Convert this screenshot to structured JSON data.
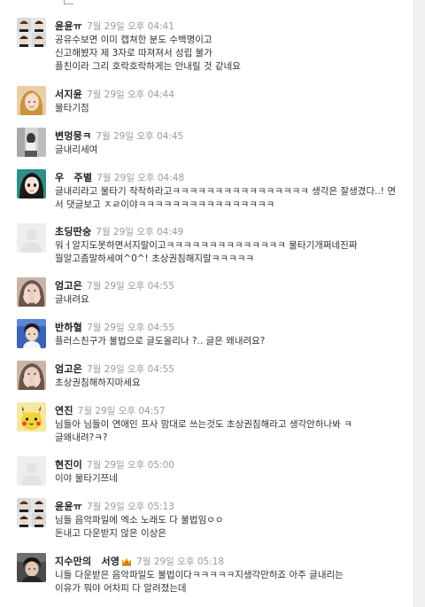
{
  "comments": [
    {
      "author": "윤윤ㅠ",
      "time": "7월 29일 오후 04:41",
      "text": "공유수보면 이미 캡쳐한 분도 수백명이고\n신고해봤자 제 3자로 따져져서 성립 불가\n플친이라 그리 호락호락하게는 안내릴 것 같네요",
      "avatar": "two-boys-avatar"
    },
    {
      "author": "서지윤",
      "time": "7월 29일 오후 04:44",
      "text": "물타기점",
      "avatar": "blonde-girl-avatar"
    },
    {
      "author": "변멍뭉ㅋ",
      "time": "7월 29일 오후 04:45",
      "text": "글내리세여",
      "avatar": "grey-photo-avatar"
    },
    {
      "author": "우　주별",
      "time": "7월 29일 오후 04:48",
      "text": "글내리라고 물타기 작작하라고ㅋㅋㅋㅋㅋㅋㅋㅋㅋㅋㅋㅋㅋㅋㅋㅋ 생각은 잘생겼다..! 면서 댓글보고 ㅈㄹ이야ㅋㅋㅋㅋㅋㅋㅋㅋㅋㅋㅋㅋㅋㅋㅋㅋ",
      "avatar": "anime-girl-avatar"
    },
    {
      "author": "초딩딴숭",
      "time": "7월 29일 오후 04:49",
      "text": "워ㅓ알지도못하면서지랄이고ㅋㅋㅋㅋㅋㅋㅋㅋㅋㅋㅋㅋㅋㅋ 물타기개쩌네진짜\n뭘알고좀말하세여^0^! 초상권침해지랄ㅋㅋㅋㅋㅋ",
      "avatar": "default-avatar"
    },
    {
      "author": "엄고은",
      "time": "7월 29일 오후 04:55",
      "text": "글내려요",
      "avatar": "covered-face-avatar"
    },
    {
      "author": "반하혈",
      "time": "7월 29일 오후 04:55",
      "text": "플러스친구가 불법으로 글도올리나 ?.. 글은 왜내려요?",
      "avatar": "blue-boy-avatar"
    },
    {
      "author": "엄고은",
      "time": "7월 29일 오후 04:55",
      "text": "초상권침해하지마세요",
      "avatar": "covered-face-avatar"
    },
    {
      "author": "연진",
      "time": "7월 29일 오후 04:57",
      "text": "님들아 님들이 연애인 프사 맘대로 쓰는것도 초상권침해라고 생각안하나봐 ㅋ\n글왜내려?ㅋ?",
      "avatar": "pikachu-avatar"
    },
    {
      "author": "현진이",
      "time": "7월 29일 오후 05:00",
      "text": "이야 물타기쯔네",
      "avatar": "default-avatar"
    },
    {
      "author": "윤윤ㅠ",
      "time": "7월 29일 오후 05:13",
      "text": "님들 음악파일에 엑소 노래도 다 불법임ㅇㅇ\n돈내고 다운받지 않은 이상은",
      "avatar": "two-boys-avatar"
    },
    {
      "author": "지수만의　서영",
      "time": "7월 29일 오후 05:18",
      "text": "니들 다운받은 음악파일도 불법이다ㅋㅋㅋㅋㅋ지생각만하죠 아주 글내리는\n이유가 뭐야 어차피 다 알려졌는데",
      "avatar": "dark-boy-avatar",
      "badge": "crown-icon"
    }
  ],
  "colors": {
    "author": "#222222",
    "time": "#9b9b9b",
    "text": "#333333",
    "crown": "#e8a21a"
  }
}
